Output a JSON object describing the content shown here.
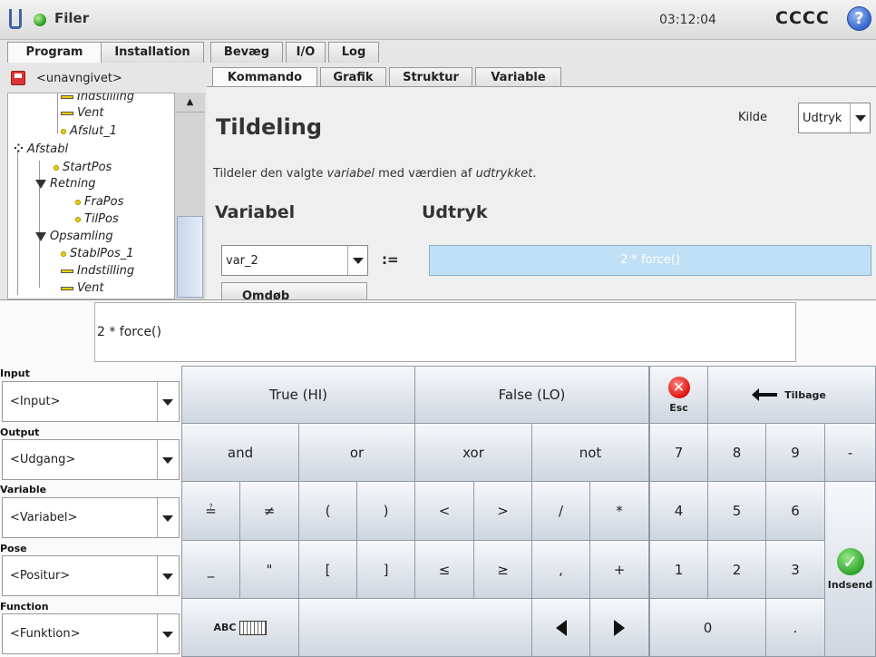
{
  "titlebar": {
    "title": "Filer",
    "clock": "03:12:04",
    "robot_name": "CCCC",
    "help": "?"
  },
  "main_tabs": [
    "Program",
    "Installation",
    "Bevæg",
    "I/O",
    "Log"
  ],
  "file": {
    "name": "<unavngivet>"
  },
  "sub_tabs": [
    "Kommando",
    "Grafik",
    "Struktur",
    "Variable"
  ],
  "tree": {
    "items": [
      {
        "label": "Indstilling",
        "icon": "bar"
      },
      {
        "label": "Vent",
        "icon": "bar"
      },
      {
        "label": "Afslut_1",
        "icon": "dot"
      },
      {
        "label": "Afstabl",
        "icon": "pattern"
      },
      {
        "label": "StartPos",
        "icon": "dot"
      },
      {
        "label": "Retning",
        "icon": "triangle"
      },
      {
        "label": "FraPos",
        "icon": "dot"
      },
      {
        "label": "TilPos",
        "icon": "dot"
      },
      {
        "label": "Opsamling",
        "icon": "triangle"
      },
      {
        "label": "StablPos_1",
        "icon": "dot"
      },
      {
        "label": "Indstilling",
        "icon": "bar"
      },
      {
        "label": "Vent",
        "icon": "bar"
      }
    ]
  },
  "command": {
    "title": "Tildeling",
    "kilde_label": "Kilde",
    "kilde_value": "Udtryk",
    "desc_pre": "Tildeler den valgte ",
    "desc_var": "variabel",
    "desc_mid": " med værdien af ",
    "desc_expr": "udtrykket",
    "desc_post": ".",
    "variable_heading": "Variabel",
    "expression_heading": "Udtryk",
    "variable_value": "var_2",
    "assign_op": ":=",
    "expression_value": "2 * force()",
    "rename_label": "Omdøb"
  },
  "editor": {
    "field_value": "2 * force()",
    "input_label": "Input",
    "input_value": "<Input>",
    "output_label": "Output",
    "output_value": "<Udgang>",
    "variable_label": "Variable",
    "variable_value": "<Variabel>",
    "pose_label": "Pose",
    "pose_value": "<Positur>",
    "function_label": "Function",
    "function_value": "<Funktion>"
  },
  "keys": {
    "true_hi": "True (HI)",
    "false_lo": "False (LO)",
    "esc": "Esc",
    "back": "Tilbage",
    "and": "and",
    "or": "or",
    "xor": "xor",
    "not": "not",
    "eq": "≟",
    "neq": "≠",
    "lparen": "(",
    "rparen": ")",
    "lt": "<",
    "gt": ">",
    "div": "/",
    "mul": "*",
    "underscore": "_",
    "quote": "\"",
    "lbracket": "[",
    "rbracket": "]",
    "le": "≤",
    "ge": "≥",
    "comma": ",",
    "plus": "+",
    "n7": "7",
    "n8": "8",
    "n9": "9",
    "minus": "-",
    "n4": "4",
    "n5": "5",
    "n6": "6",
    "n1": "1",
    "n2": "2",
    "n3": "3",
    "n0": "0",
    "dot": ".",
    "submit": "Indsend",
    "abc": "ABC"
  }
}
